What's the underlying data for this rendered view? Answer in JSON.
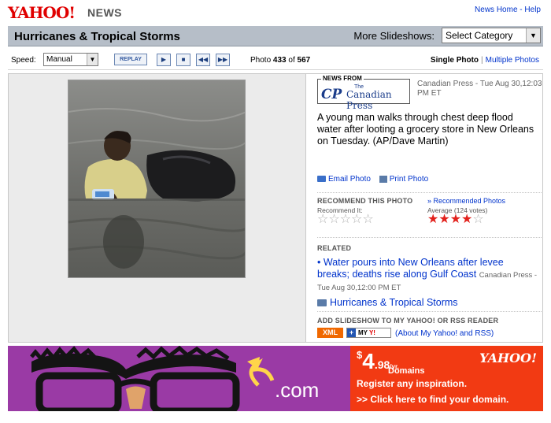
{
  "header": {
    "logo_text": "YAHOO!",
    "logo_section": "NEWS",
    "links": [
      "News Home",
      "Help"
    ],
    "link_separator": "-"
  },
  "titlebar": {
    "title": "Hurricanes & Tropical Storms",
    "more_label": "More Slideshows:",
    "category_select": "Select Category"
  },
  "controls": {
    "speed_label": "Speed:",
    "speed_value": "Manual",
    "replay_label": "REPLAY",
    "play_icon": "play-icon",
    "stop_icon": "stop-icon",
    "prev_icon": "rewind-icon",
    "next_icon": "fast-forward-icon",
    "photo_word": "Photo",
    "photo_index": "433",
    "of_word": "of",
    "photo_total": "567",
    "view_single": "Single Photo",
    "view_multiple": "Multiple Photos"
  },
  "photo": {
    "source_label": "NEWS FROM",
    "source_logo": "The Canadian Press",
    "source_logo_the": "The",
    "source_logo_name": "Canadian Press",
    "credit": "Canadian Press - Tue Aug 30,12:03 PM ET",
    "caption": "A young man walks through chest deep flood water after looting a grocery store in New Orleans on Tuesday. (AP/Dave Martin)",
    "email_label": "Email Photo",
    "print_label": "Print Photo"
  },
  "recommend": {
    "heading": "RECOMMEND THIS PHOTO",
    "link": "» Recommended Photos",
    "user_label": "Recommend It:",
    "user_rating": 0,
    "average_label": "Average (124 votes)",
    "average_rating": 4,
    "max_rating": 5
  },
  "related": {
    "heading": "RELATED",
    "bullet": "•",
    "story_title": "Water pours into New Orleans after levee breaks; deaths rise along Gulf Coast",
    "story_source": "Canadian Press - Tue Aug 30,12:00 PM ET",
    "category_link": "Hurricanes & Tropical Storms"
  },
  "rss": {
    "heading": "ADD SLIDESHOW TO MY YAHOO! OR RSS READER",
    "xml_label": "XML",
    "myyahoo_plus": "+",
    "myyahoo_my": "MY",
    "myyahoo_y": "Y!",
    "about_link": "(About My Yahoo! and RSS)"
  },
  "ad": {
    "dotcom": ".com",
    "price_dollar": "$",
    "price_main": "4",
    "price_cents": ".98",
    "price_unit": "/yr.",
    "domains": "Domains",
    "brand": "YAHOO!",
    "register": "Register any inspiration.",
    "cta": ">> Click here to find your domain.",
    "colors": {
      "left_bg": "#9a3aa5",
      "right_bg": "#f23a13"
    }
  },
  "colors": {
    "link": "#0033cc",
    "titlebar_bg": "#b6bec8",
    "star_full": "#e2211c",
    "logo_red": "#e00000"
  }
}
